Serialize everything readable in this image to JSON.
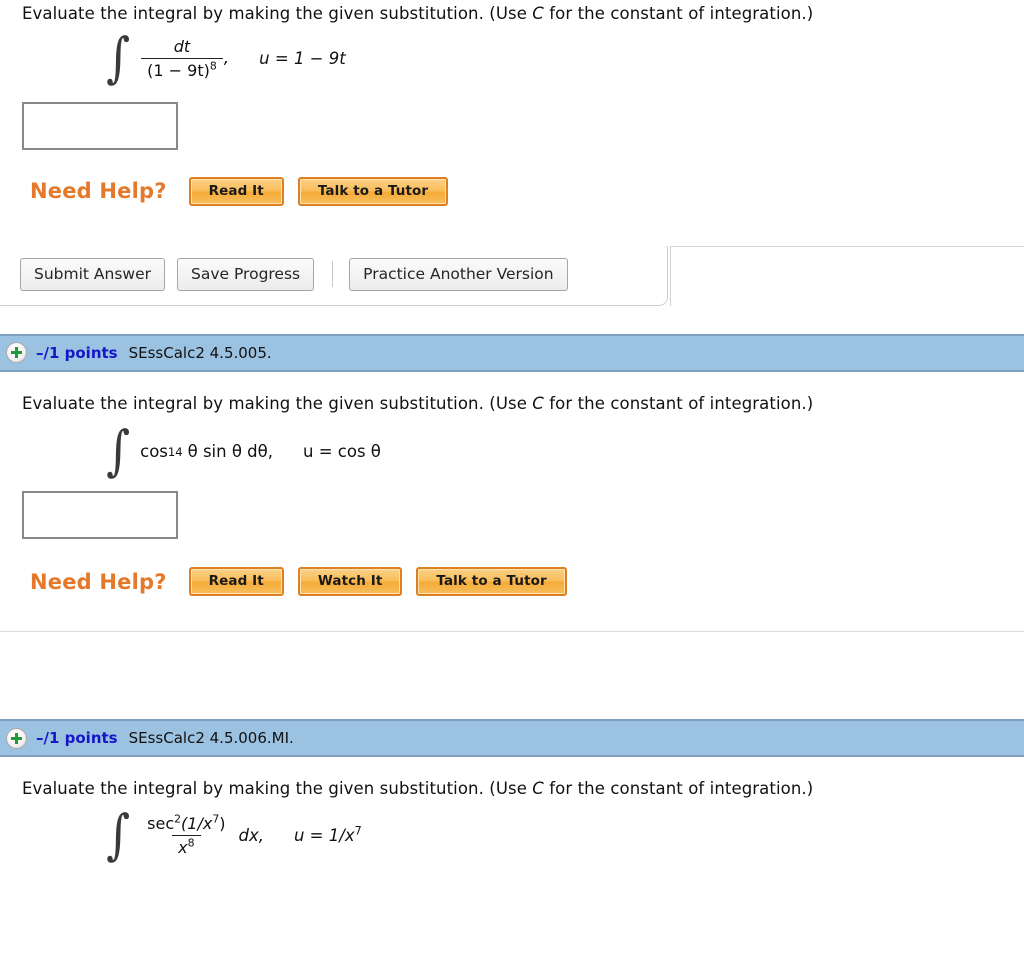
{
  "problems": [
    {
      "prompt_pre": "Evaluate the integral by making the given substitution. (Use ",
      "prompt_var": "C",
      "prompt_post": " for the constant of integration.)",
      "integral": {
        "numerator": "dt",
        "denominator_base": "(1 − 9t)",
        "denominator_exp": "8",
        "trailing": ",",
        "substitution": "u = 1 − 9t"
      },
      "answer_value": "",
      "answer_placeholder": "",
      "need_help_label": "Need Help?",
      "help_buttons": [
        "Read It",
        "Talk to a Tutor"
      ],
      "action_buttons": [
        "Submit Answer",
        "Save Progress"
      ],
      "practice_button": "Practice Another Version"
    },
    {
      "header": {
        "expand_icon": "plus-circle-icon",
        "points": "–/1 points",
        "code": "SEssCalc2 4.5.005."
      },
      "prompt_pre": "Evaluate the integral by making the given substitution. (Use ",
      "prompt_var": "C",
      "prompt_post": " for the constant of integration.)",
      "integral": {
        "expression_main": "cos",
        "exponent": "14",
        "expression_rest": "θ sin θ dθ,",
        "substitution": "u = cos θ"
      },
      "answer_value": "",
      "answer_placeholder": "",
      "need_help_label": "Need Help?",
      "help_buttons": [
        "Read It",
        "Watch It",
        "Talk to a Tutor"
      ]
    },
    {
      "header": {
        "expand_icon": "plus-circle-icon",
        "points": "–/1 points",
        "code": "SEssCalc2 4.5.006.MI."
      },
      "prompt_pre": "Evaluate the integral by making the given substitution. (Use ",
      "prompt_var": "C",
      "prompt_post": " for the constant of integration.)",
      "integral": {
        "numerator_fn": "sec",
        "numerator_exp": "2",
        "numerator_arg": "(1/x",
        "numerator_arg_exp": "7",
        "numerator_arg_close": ")",
        "denominator_base": "x",
        "denominator_exp": "8",
        "differential": "dx,",
        "substitution_pre": "u = 1/x",
        "substitution_exp": "7"
      }
    }
  ],
  "colors": {
    "header_blue": "#9cc2e1",
    "header_border": "#7e9fbe",
    "points_blue": "#1617c9",
    "need_help_orange": "#e5792b",
    "help_button_border": "#de7f21",
    "plus_green": "#1f9a36"
  }
}
